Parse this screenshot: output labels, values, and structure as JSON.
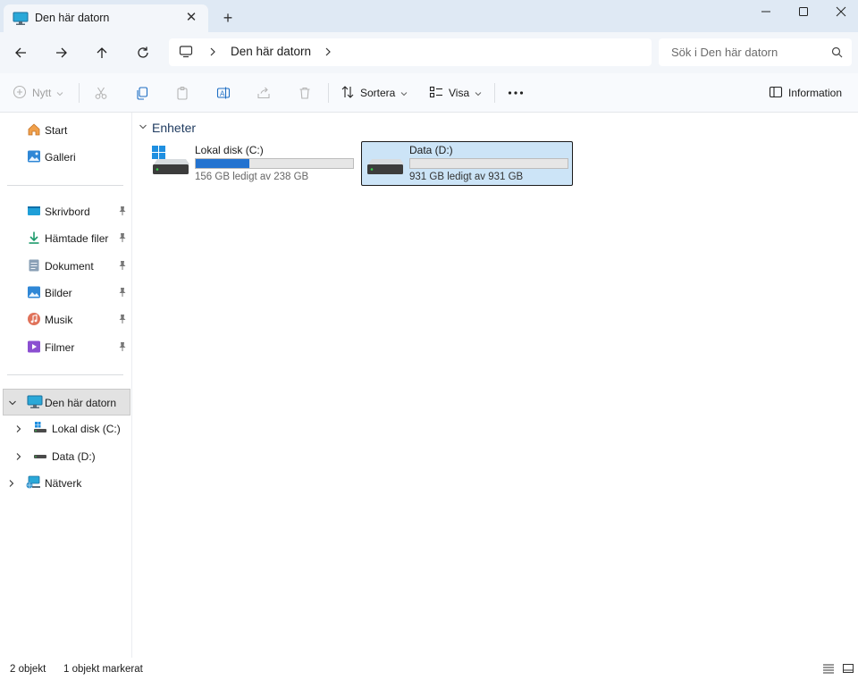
{
  "window": {
    "tab_title": "Den här datorn",
    "tab_icon": "computer-icon",
    "new_tab_icon": "plus-icon",
    "minimize_icon": "minimize-icon",
    "maximize_icon": "maximize-icon",
    "close_icon": "close-icon"
  },
  "nav": {
    "back_icon": "arrow-left-icon",
    "forward_icon": "arrow-right-icon",
    "up_icon": "arrow-up-icon",
    "refresh_icon": "refresh-icon",
    "breadcrumb": [
      "Den här datorn"
    ],
    "search_placeholder": "Sök i Den här datorn"
  },
  "commandbar": {
    "new_label": "Nytt",
    "sort_label": "Sortera",
    "view_label": "Visa",
    "more_icon": "more-icon",
    "info_label": "Information",
    "disabled_actions": [
      "cut-icon",
      "paste-icon",
      "share-icon",
      "delete-icon"
    ],
    "enabled_actions": [
      "copy-icon",
      "rename-icon"
    ]
  },
  "sidebar": {
    "top": [
      {
        "label": "Start",
        "icon": "home-icon"
      },
      {
        "label": "Galleri",
        "icon": "gallery-icon"
      }
    ],
    "quick_access": [
      {
        "label": "Skrivbord",
        "icon": "desktop-folder-icon",
        "pinned": true
      },
      {
        "label": "Hämtade filer",
        "icon": "download-folder-icon",
        "pinned": true
      },
      {
        "label": "Dokument",
        "icon": "documents-folder-icon",
        "pinned": true
      },
      {
        "label": "Bilder",
        "icon": "pictures-folder-icon",
        "pinned": true
      },
      {
        "label": "Musik",
        "icon": "music-folder-icon",
        "pinned": true
      },
      {
        "label": "Filmer",
        "icon": "videos-folder-icon",
        "pinned": true
      }
    ],
    "this_pc": {
      "label": "Den här datorn",
      "icon": "computer-icon",
      "expanded": true,
      "selected": true
    },
    "drives": [
      {
        "label": "Lokal disk (C:)",
        "icon": "windows-drive-icon"
      },
      {
        "label": "Data (D:)",
        "icon": "drive-icon"
      }
    ],
    "network": {
      "label": "Nätverk",
      "icon": "network-icon"
    }
  },
  "content": {
    "group_label": "Enheter",
    "drives": [
      {
        "name": "Lokal disk (C:)",
        "free_text": "156 GB ledigt av 238 GB",
        "used_fraction": 0.34,
        "selected": false
      },
      {
        "name": "Data (D:)",
        "free_text": "931 GB ledigt av 931 GB",
        "used_fraction": 0.0,
        "selected": true
      }
    ]
  },
  "status": {
    "count": "2 objekt",
    "selected": "1 objekt markerat"
  },
  "colors": {
    "accent": "#2473d0",
    "selection": "#cce4f7",
    "titlebar": "#dfe9f4"
  }
}
